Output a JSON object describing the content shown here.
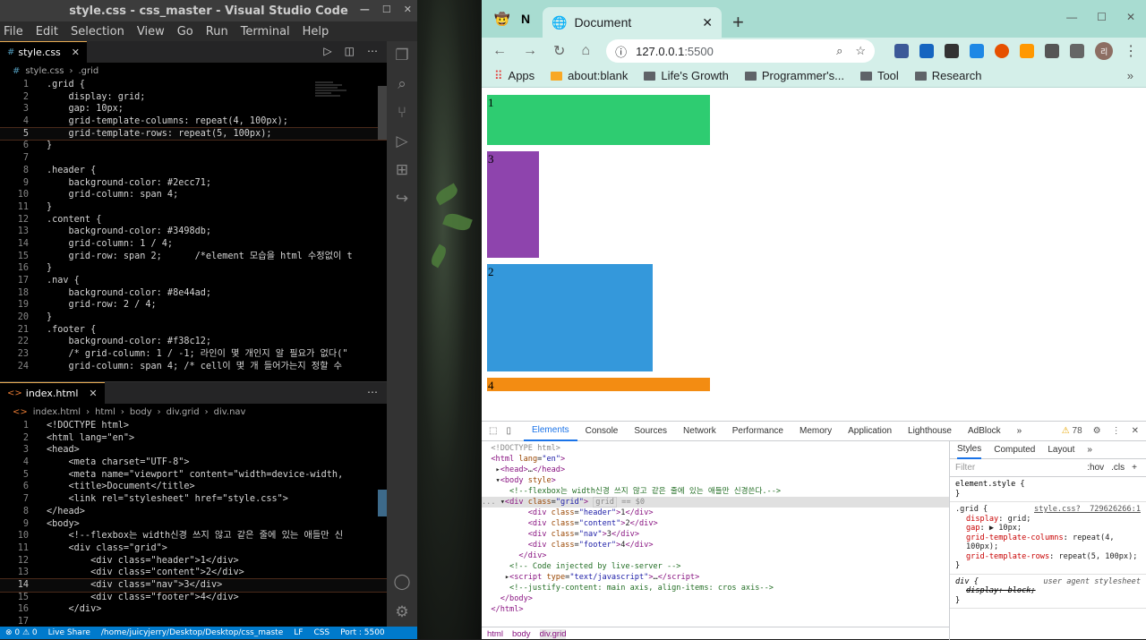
{
  "vscode": {
    "title": "style.css - css_master - Visual Studio Code",
    "menu": [
      "File",
      "Edit",
      "Selection",
      "View",
      "Go",
      "Run",
      "Terminal",
      "Help"
    ],
    "tab_css": "style.css",
    "crumbs_css": [
      "style.css",
      ".grid"
    ],
    "css_lines": [
      ".grid {",
      "    display: grid;",
      "    gap: 10px;",
      "    grid-template-columns: repeat(4, 100px);",
      "    grid-template-rows: repeat(5, 100px);",
      "}",
      "",
      ".header {",
      "    background-color: #2ecc71;",
      "    grid-column: span 4;",
      "}",
      ".content {",
      "    background-color: #3498db;",
      "    grid-column: 1 / 4;",
      "    grid-row: span 2;      /*element 모습을 html 수정없이 t",
      "}",
      ".nav {",
      "    background-color: #8e44ad;",
      "    grid-row: 2 / 4;",
      "}",
      ".footer {",
      "    background-color: #f38c12;",
      "    /* grid-column: 1 / -1; 라인이 몇 개인지 알 필요가 없다(\"",
      "    grid-column: span 4; /* cell이 몇 개 들어가는지 정할 수 "
    ],
    "tab_html": "index.html",
    "crumbs_html": [
      "index.html",
      "html",
      "body",
      "div.grid",
      "div.nav"
    ],
    "html_lines": [
      "<!DOCTYPE html>",
      "<html lang=\"en\">",
      "<head>",
      "    <meta charset=\"UTF-8\">",
      "    <meta name=\"viewport\" content=\"width=device-width,",
      "    <title>Document</title>",
      "    <link rel=\"stylesheet\" href=\"style.css\">",
      "</head>",
      "<body>",
      "    <!--flexbox는 width신경 쓰지 않고 같은 줄에 있는 애들만 신",
      "    <div class=\"grid\">",
      "        <div class=\"header\">1</div>",
      "        <div class=\"content\">2</div>",
      "        <div class=\"nav\">3</div>",
      "        <div class=\"footer\">4</div>",
      "    </div>",
      ""
    ],
    "status": {
      "errors": "⊗ 0 ⚠ 0",
      "live_share": "Live Share",
      "path": "/home/juicyjerry/Desktop/Desktop/css_maste",
      "eol": "LF",
      "lang": "CSS",
      "port": "Port : 5500"
    }
  },
  "chrome": {
    "tab_title": "Document",
    "url_host": "127.0.0.1",
    "url_port": ":5500",
    "bookmarks": [
      "Apps",
      "about:blank",
      "Life's Growth",
      "Programmer's...",
      "Tool",
      "Research"
    ],
    "avatar": "리",
    "page_cells": [
      {
        "label": "1",
        "color": "#2ecc71"
      },
      {
        "label": "3",
        "color": "#8e44ad"
      },
      {
        "label": "2",
        "color": "#3498db"
      },
      {
        "label": "4",
        "color": "#f38c12"
      }
    ]
  },
  "devtools": {
    "tabs": [
      "Elements",
      "Console",
      "Sources",
      "Network",
      "Performance",
      "Memory",
      "Application",
      "Lighthouse",
      "AdBlock"
    ],
    "warnings": "78",
    "crumbs": [
      "html",
      "body",
      "div.grid"
    ],
    "style_tabs": [
      "Styles",
      "Computed",
      "Layout"
    ],
    "filter_placeholder": "Filter",
    "hov": ":hov",
    "cls": ".cls",
    "rules": {
      "element_style": "element.style {",
      "grid_selector": ".grid {",
      "grid_source": "style.css? _729626266:1",
      "grid_props": [
        {
          "name": "display",
          "value": "grid;"
        },
        {
          "name": "gap",
          "value": "▶ 10px;"
        },
        {
          "name": "grid-template-columns",
          "value": "repeat(4, 100px);"
        },
        {
          "name": "grid-template-rows",
          "value": "repeat(5, 100px);"
        }
      ],
      "div_selector": "div {",
      "div_source": "user agent stylesheet",
      "div_prop": "display: block;"
    }
  }
}
